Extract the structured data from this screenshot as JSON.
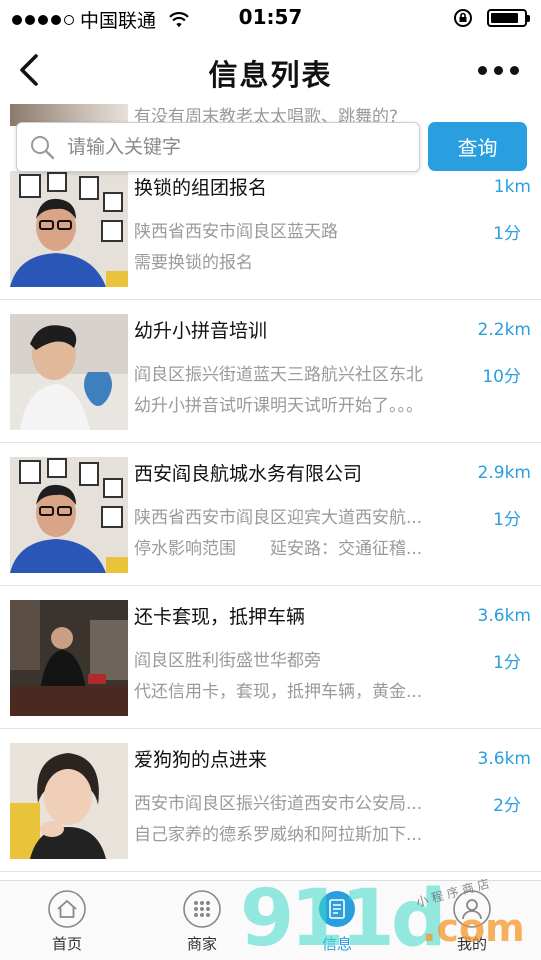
{
  "status_bar": {
    "carrier": "中国联通",
    "time": "01:57",
    "battery_level": 0.85
  },
  "nav": {
    "title": "信息列表"
  },
  "peek_item": {
    "text": "有没有周末教老太太唱歌、跳舞的?"
  },
  "search": {
    "placeholder": "请输入关键字",
    "value": "",
    "button_label": "查询"
  },
  "items": [
    {
      "title": "换锁的组团报名",
      "distance": "1km",
      "address": "陕西省西安市阎良区蓝天路",
      "time": "1分",
      "description": "需要换锁的报名",
      "thumb_icon": "avatar-man-glasses-photo"
    },
    {
      "title": "幼升小拼音培训",
      "distance": "2.2km",
      "address": "阎良区振兴街道蓝天三路航兴社区东北",
      "time": "10分",
      "description": "幼升小拼音试听课明天试听开始了。。。",
      "thumb_icon": "avatar-man-vase-photo"
    },
    {
      "title": "西安阎良航城水务有限公司",
      "distance": "2.9km",
      "address": "陕西省西安市阎良区迎宾大道西安航...",
      "time": "1分",
      "description": "停水影响范围　　延安路：交通征稽...",
      "thumb_icon": "avatar-man-glasses-photo"
    },
    {
      "title": "还卡套现，抵押车辆",
      "distance": "3.6km",
      "address": "阎良区胜利街盛世华都旁",
      "time": "1分",
      "description": "代还信用卡，套现，抵押车辆，黄金...",
      "thumb_icon": "avatar-man-room-photo"
    },
    {
      "title": "爱狗狗的点进来",
      "distance": "3.6km",
      "address": "西安市阎良区振兴街道西安市公安局...",
      "time": "2分",
      "description": "自己家养的德系罗威纳和阿拉斯加下...",
      "thumb_icon": "avatar-woman-photo"
    }
  ],
  "tabs": [
    {
      "label": "首页",
      "icon": "home-icon"
    },
    {
      "label": "商家",
      "icon": "grid-dots-icon"
    },
    {
      "label": "信息",
      "icon": "info-list-icon",
      "active": true
    },
    {
      "label": "我的",
      "icon": "user-icon"
    }
  ],
  "watermark": {
    "big": "911d",
    "com": ".com",
    "small": "小 程 序 商 店"
  },
  "colors": {
    "accent": "#2a9fe0",
    "muted_text": "#9a9a9a",
    "divider": "#e2e2e2"
  }
}
